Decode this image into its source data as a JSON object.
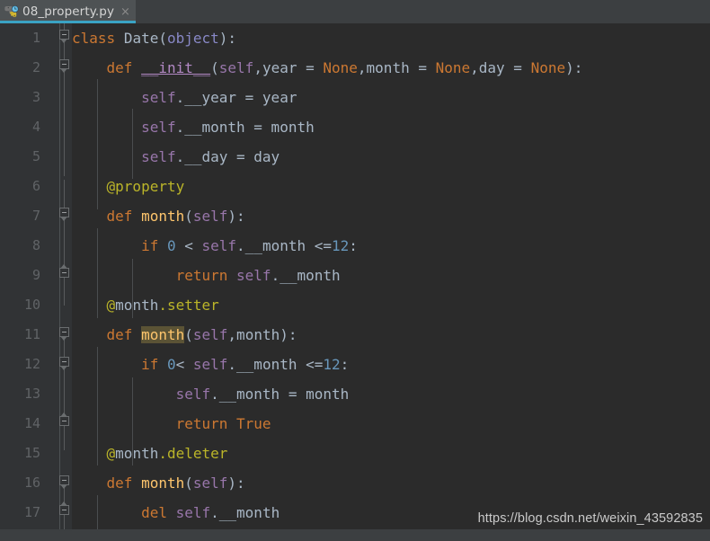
{
  "window": {
    "theme": "darcula",
    "colors": {
      "editor_bg": "#2b2b2b",
      "gutter_bg": "#313335",
      "tabbar_bg": "#3c3f41",
      "active_tab_bg": "#4e5254",
      "tab_accent": "#3aa3c4",
      "keyword": "#cc7832",
      "self_param": "#9876aa",
      "number": "#6897bb",
      "decorator": "#bbb529",
      "function_name": "#ffc66d",
      "default_text": "#a9b7c6",
      "line_number": "#606366",
      "identifier_highlight": "#5b5335"
    }
  },
  "tabbar": {
    "tabs": [
      {
        "label": "08_property.py",
        "icon": "python-file-icon",
        "badge": "clock-badge",
        "close_label": "×",
        "active": true
      }
    ]
  },
  "editor": {
    "language": "python",
    "first_visible_line": 1,
    "last_visible_line": 17,
    "lines": [
      {
        "n": "1",
        "indent": 0
      },
      {
        "n": "2",
        "indent": 1
      },
      {
        "n": "3",
        "indent": 2
      },
      {
        "n": "4",
        "indent": 2
      },
      {
        "n": "5",
        "indent": 2
      },
      {
        "n": "6",
        "indent": 1
      },
      {
        "n": "7",
        "indent": 1
      },
      {
        "n": "8",
        "indent": 2
      },
      {
        "n": "9",
        "indent": 3
      },
      {
        "n": "10",
        "indent": 1
      },
      {
        "n": "11",
        "indent": 1
      },
      {
        "n": "12",
        "indent": 2
      },
      {
        "n": "13",
        "indent": 3
      },
      {
        "n": "14",
        "indent": 3
      },
      {
        "n": "15",
        "indent": 1
      },
      {
        "n": "16",
        "indent": 1
      },
      {
        "n": "17",
        "indent": 2
      }
    ],
    "source_text": [
      "class Date(object):",
      "    def __init__(self,year = None,month = None,day = None):",
      "        self.__year = year",
      "        self.__month = month",
      "        self.__day = day",
      "    @property",
      "    def month(self):",
      "        if 0 < self.__month <=12:",
      "            return self.__month",
      "    @month.setter",
      "    def month(self,month):",
      "        if 0< self.__month <=12:",
      "            self.__month = month",
      "            return True",
      "    @month.deleter",
      "    def month(self):",
      "        del self.__month"
    ],
    "highlighted_identifier": "month",
    "highlighted_on_line": "11"
  },
  "watermark": {
    "text": "https://blog.csdn.net/weixin_43592835"
  }
}
